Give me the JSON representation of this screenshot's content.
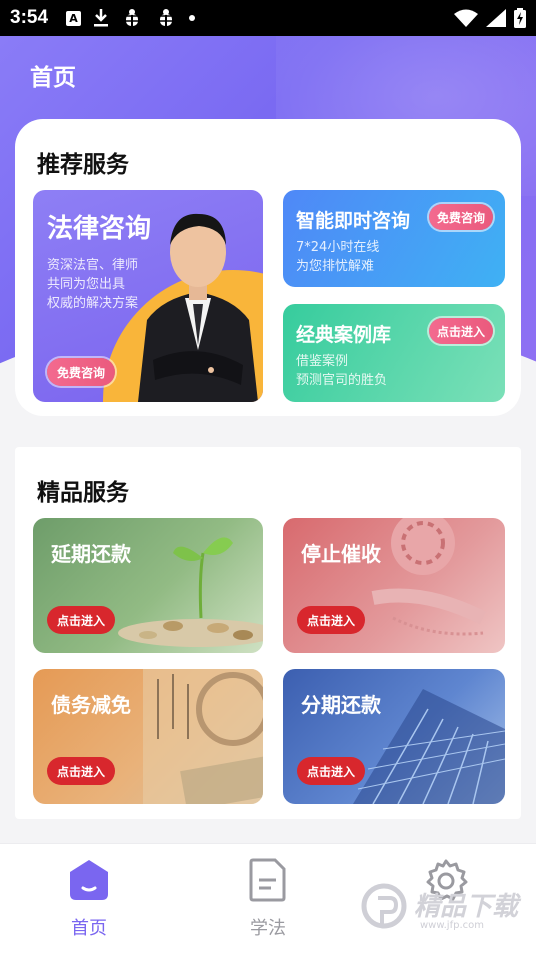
{
  "status_bar": {
    "time": "3:54",
    "a_badge": "A"
  },
  "header": {
    "title": "首页"
  },
  "recommended": {
    "title": "推荐服务",
    "legal": {
      "title": "法律咨询",
      "lines": [
        "资深法官、律师",
        "共同为您出具",
        "权威的解决方案"
      ],
      "button": "免费咨询"
    },
    "smart": {
      "title": "智能即时咨询",
      "lines": [
        "7*24小时在线",
        "为您排忧解难"
      ],
      "button": "免费咨询"
    },
    "cases": {
      "title": "经典案例库",
      "lines": [
        "借鉴案例",
        "预测官司的胜负"
      ],
      "button": "点击进入"
    }
  },
  "premium": {
    "title": "精品服务",
    "items": [
      {
        "title": "延期还款",
        "button": "点击进入"
      },
      {
        "title": "停止催收",
        "button": "点击进入"
      },
      {
        "title": "债务减免",
        "button": "点击进入"
      },
      {
        "title": "分期还款",
        "button": "点击进入"
      }
    ]
  },
  "nav": {
    "items": [
      {
        "label": "首页",
        "active": true
      },
      {
        "label": "学法",
        "active": false
      },
      {
        "label": "",
        "active": false
      }
    ],
    "active_color": "#7a66f0",
    "inactive_color": "#9a9aa0"
  },
  "watermark": {
    "text": "精品下载",
    "url": "www.jfp.com"
  }
}
